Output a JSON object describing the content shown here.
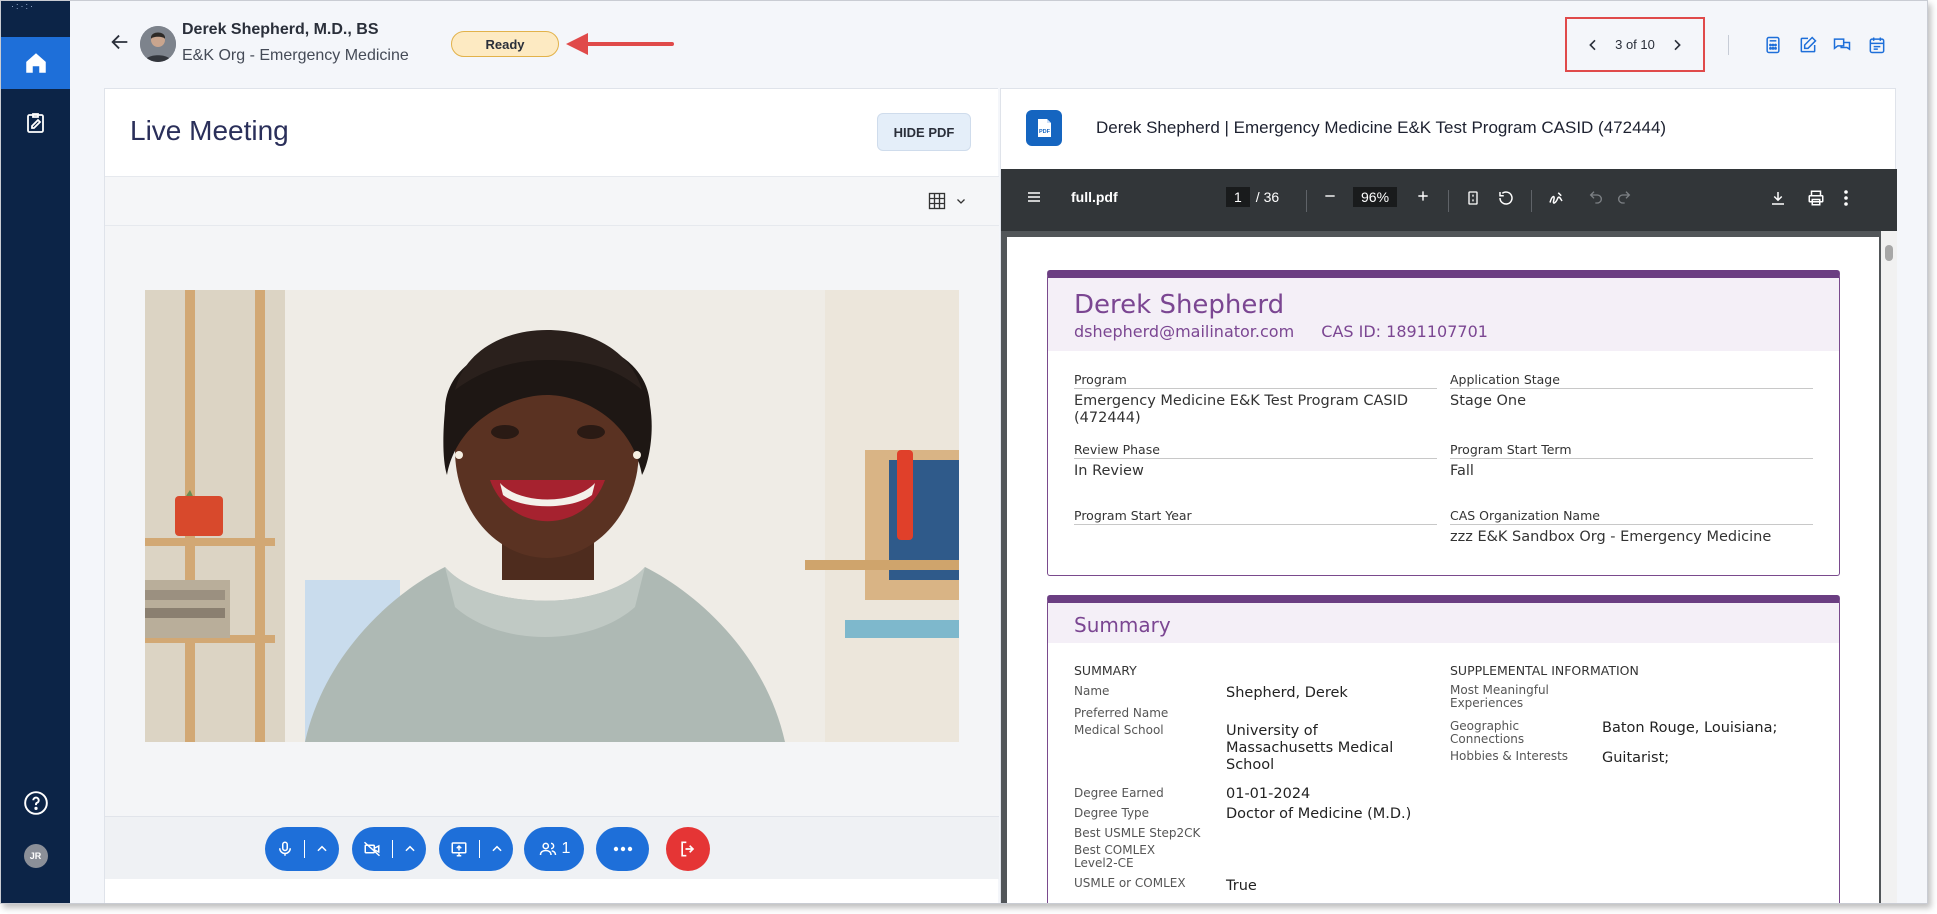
{
  "sidebar": {
    "logo": "·:·:·",
    "avatar_initials": "JR"
  },
  "header": {
    "name": "Derek Shepherd, M.D., BS",
    "org": "E&K Org - Emergency Medicine",
    "status": "Ready",
    "pager": "3 of 10",
    "colors": {
      "accent": "#1e6fd9",
      "ready_bg": "#fdeac2",
      "annotation": "#e04a4a"
    }
  },
  "meeting": {
    "title": "Live Meeting",
    "hide_pdf": "HIDE PDF",
    "participants": "1"
  },
  "pdf": {
    "title": "Derek Shepherd | Emergency Medicine E&K Test Program CASID (472444)",
    "toolbar": {
      "file": "full.pdf",
      "page": "1",
      "total": "/ 36",
      "zoom": "96%"
    },
    "doc": {
      "name": "Derek Shepherd",
      "email": "dshepherd@mailinator.com",
      "cas_id": "CAS ID: 1891107701",
      "fields": [
        {
          "label": "Program",
          "value": "Emergency Medicine E&K Test Program CASID (472444)"
        },
        {
          "label": "Application Stage",
          "value": "Stage One"
        },
        {
          "label": "Review Phase",
          "value": "In Review"
        },
        {
          "label": "Program Start Term",
          "value": "Fall"
        },
        {
          "label": "Program Start Year",
          "value": ""
        },
        {
          "label": "CAS Organization Name",
          "value": "zzz E&K Sandbox Org - Emergency Medicine"
        }
      ],
      "summary_title": "Summary",
      "summary_head": "SUMMARY",
      "supp_head": "SUPPLEMENTAL INFORMATION",
      "summary": [
        {
          "label": "Name",
          "value": "Shepherd, Derek"
        },
        {
          "label": "Preferred Name",
          "value": ""
        },
        {
          "label": "Medical School",
          "value": "University of Massachusetts Medical School"
        },
        {
          "label": "Degree Earned",
          "value": "01-01-2024"
        },
        {
          "label": "Degree Type",
          "value": "Doctor of Medicine (M.D.)"
        },
        {
          "label": "Best USMLE Step2CK",
          "value": ""
        },
        {
          "label": "Best COMLEX Level2-CE",
          "value": ""
        },
        {
          "label": "USMLE or COMLEX",
          "value": "True"
        }
      ],
      "supplemental": [
        {
          "label": "Most Meaningful Experiences",
          "value": ""
        },
        {
          "label": "Geographic Connections",
          "value": "Baton Rouge, Louisiana;"
        },
        {
          "label": "Hobbies & Interests",
          "value": "Guitarist;"
        }
      ]
    }
  }
}
